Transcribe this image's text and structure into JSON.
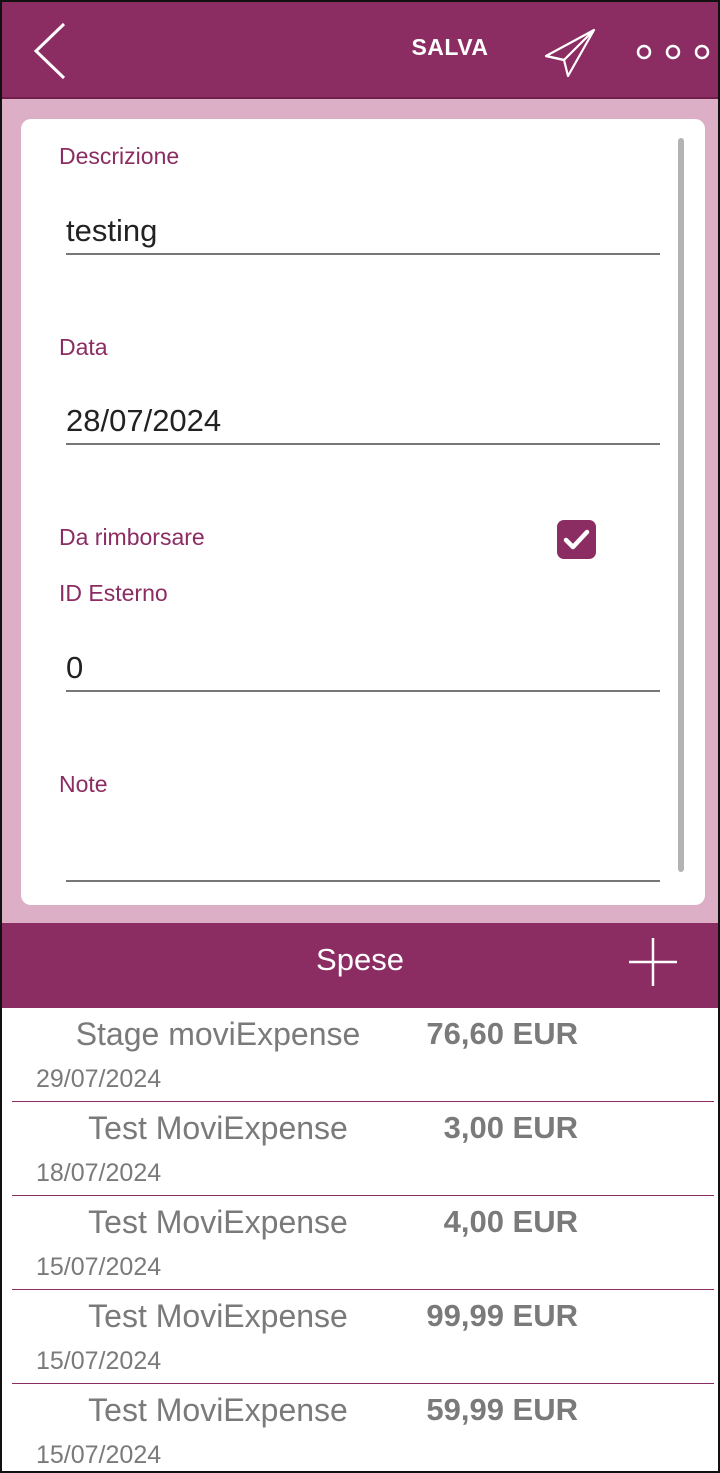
{
  "topbar": {
    "save_label": "SALVA",
    "back_icon": "chevron-left-icon",
    "send_icon": "paper-plane-icon",
    "more_icon": "more-dots-icon",
    "accent_color": "#8b2c62"
  },
  "form": {
    "descrizione_label": "Descrizione",
    "descrizione_value": "testing",
    "data_label": "Data",
    "data_value": "28/07/2024",
    "rimborsare_label": "Da rimborsare",
    "rimborsare_checked": true,
    "id_esterno_label": "ID Esterno",
    "id_esterno_value": "0",
    "note_label": "Note",
    "note_value": ""
  },
  "spese": {
    "title": "Spese",
    "add_icon": "plus-icon",
    "items": [
      {
        "name": "Stage moviExpense",
        "amount": "76,60 EUR",
        "date": "29/07/2024"
      },
      {
        "name": "Test MoviExpense",
        "amount": "3,00 EUR",
        "date": "18/07/2024"
      },
      {
        "name": "Test MoviExpense",
        "amount": "4,00 EUR",
        "date": "15/07/2024"
      },
      {
        "name": "Test MoviExpense",
        "amount": "99,99 EUR",
        "date": "15/07/2024"
      },
      {
        "name": "Test MoviExpense",
        "amount": "59,99 EUR",
        "date": "15/07/2024"
      }
    ]
  }
}
